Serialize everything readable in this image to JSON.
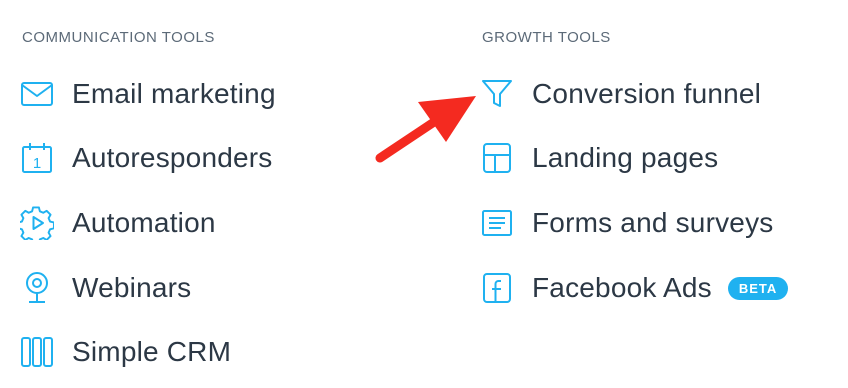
{
  "left_column": {
    "heading": "COMMUNICATION TOOLS",
    "items": [
      {
        "label": "Email marketing",
        "icon": "envelope-icon"
      },
      {
        "label": "Autoresponders",
        "icon": "calendar-icon"
      },
      {
        "label": "Automation",
        "icon": "gear-play-icon"
      },
      {
        "label": "Webinars",
        "icon": "webcam-icon"
      },
      {
        "label": "Simple CRM",
        "icon": "columns-icon"
      }
    ]
  },
  "right_column": {
    "heading": "GROWTH TOOLS",
    "items": [
      {
        "label": "Conversion funnel",
        "icon": "funnel-icon"
      },
      {
        "label": "Landing pages",
        "icon": "layout-icon"
      },
      {
        "label": "Forms and surveys",
        "icon": "form-icon"
      },
      {
        "label": "Facebook Ads",
        "icon": "facebook-icon",
        "badge": "BETA"
      }
    ]
  },
  "calendar_icon_number": "1",
  "colors": {
    "icon": "#1fb1f0",
    "text": "#2c3845",
    "heading": "#5c6a78",
    "badge_bg": "#1fb1f0",
    "arrow": "#f42a20"
  }
}
